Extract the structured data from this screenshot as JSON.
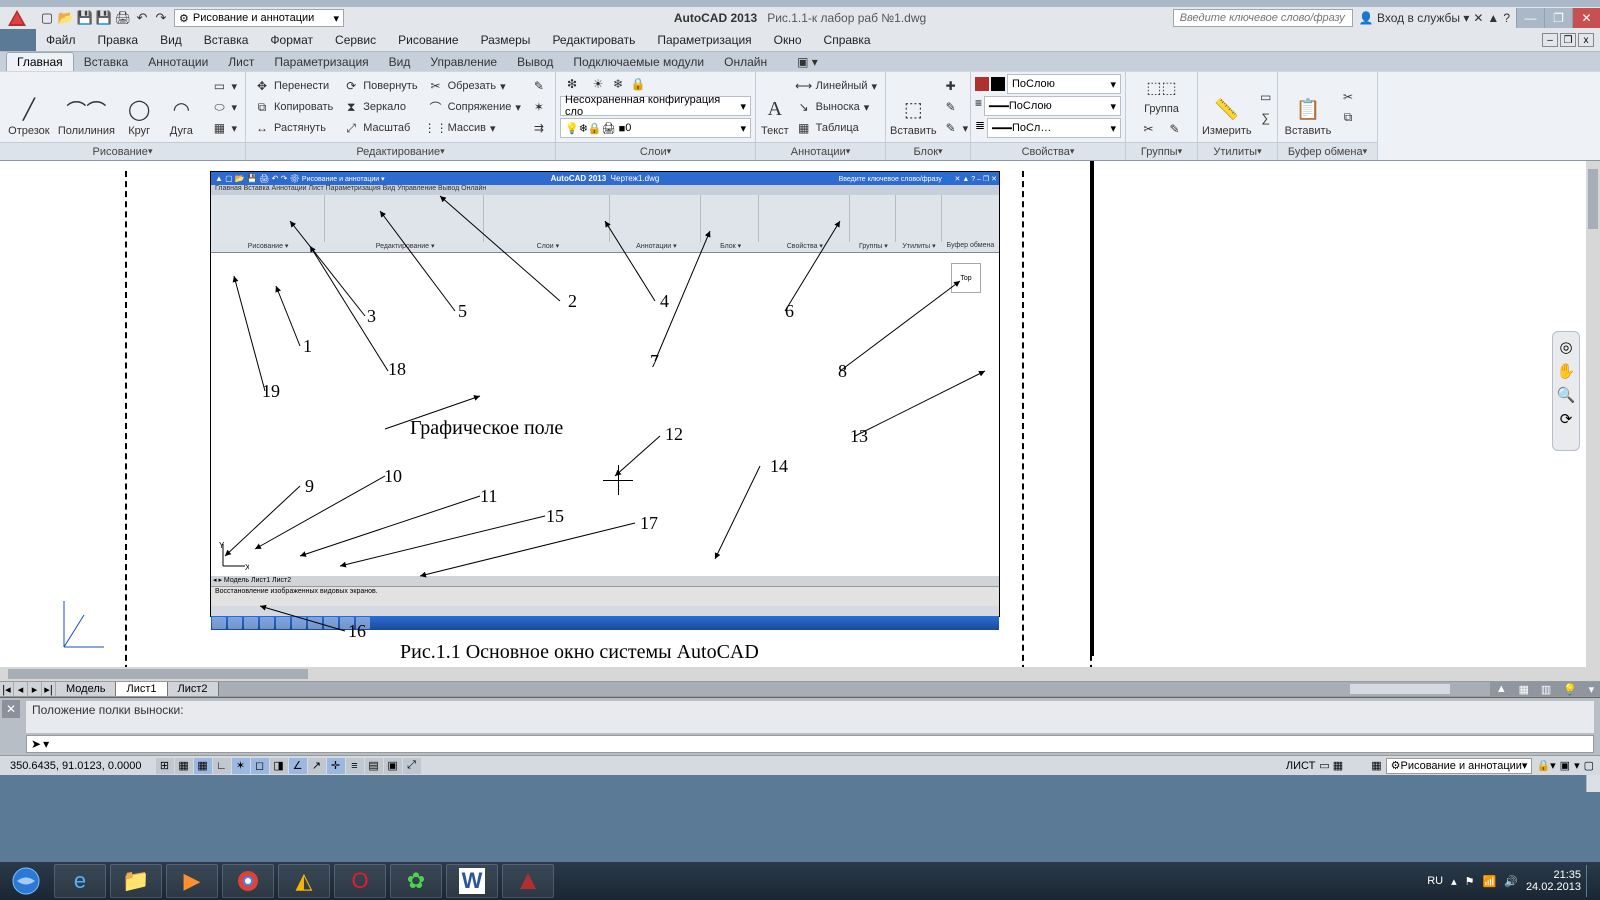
{
  "title": {
    "app": "AutoCAD 2013",
    "file": "Рис.1.1-к лабор раб №1.dwg"
  },
  "search_placeholder": "Введите ключевое слово/фразу",
  "signin": "Вход в службы",
  "workspace": "Рисование и аннотации",
  "menubar": [
    "Файл",
    "Правка",
    "Вид",
    "Вставка",
    "Формат",
    "Сервис",
    "Рисование",
    "Размеры",
    "Редактировать",
    "Параметризация",
    "Окно",
    "Справка"
  ],
  "ribbon_tabs": {
    "active": "Главная",
    "others": [
      "Вставка",
      "Аннотации",
      "Лист",
      "Параметризация",
      "Вид",
      "Управление",
      "Вывод",
      "Подключаемые модули",
      "Онлайн"
    ]
  },
  "panels": {
    "draw": {
      "title": "Рисование",
      "items": [
        "Отрезок",
        "Полилиния",
        "Круг",
        "Дуга"
      ]
    },
    "modify": {
      "title": "Редактирование",
      "col1": [
        "Перенести",
        "Копировать",
        "Растянуть"
      ],
      "col2": [
        "Повернуть",
        "Зеркало",
        "Масштаб"
      ],
      "col3": [
        "Обрезать",
        "Сопряжение",
        "Массив"
      ]
    },
    "layers": {
      "title": "Слои",
      "current_combo": "Несохраненная конфигурация сло",
      "layer_value": "0"
    },
    "annot": {
      "title": "Аннотации",
      "main": "Текст",
      "items": [
        "Линейный",
        "Выноска",
        "Таблица"
      ]
    },
    "block": {
      "title": "Блок",
      "main": "Вставить"
    },
    "props": {
      "title": "Свойства",
      "col": "ПоСлою",
      "lt": "ПоСлою",
      "lw": "ПоСл…"
    },
    "groups": {
      "title": "Группы",
      "main": "Группа"
    },
    "utils": {
      "title": "Утилиты",
      "main": "Измерить"
    },
    "clip": {
      "title": "Буфер обмена",
      "main": "Вставить"
    }
  },
  "model_tabs": [
    "Модель",
    "Лист1",
    "Лист2"
  ],
  "cmd_history": "Положение полки выноски:",
  "cmd_prompt": "",
  "status": {
    "coords": "350.6435, 91.0123, 0.0000",
    "paper_label": "ЛИСТ",
    "workspace": "Рисование и аннотации"
  },
  "figure": {
    "caption": "Рис.1.1 Основное окно системы AutoCAD",
    "graphic_label": "Графическое поле",
    "emb_title_app": "AutoCAD 2013",
    "emb_title_doc": "Чертеж1.dwg",
    "emb_cmd": "Восстановление изображенных видовых экранов."
  },
  "callouts": [
    "1",
    "2",
    "3",
    "4",
    "5",
    "6",
    "7",
    "8",
    "9",
    "10",
    "11",
    "12",
    "13",
    "14",
    "15",
    "16",
    "17",
    "18",
    "19"
  ],
  "tray": {
    "lang": "RU",
    "time": "21:35",
    "date": "24.02.2013"
  }
}
